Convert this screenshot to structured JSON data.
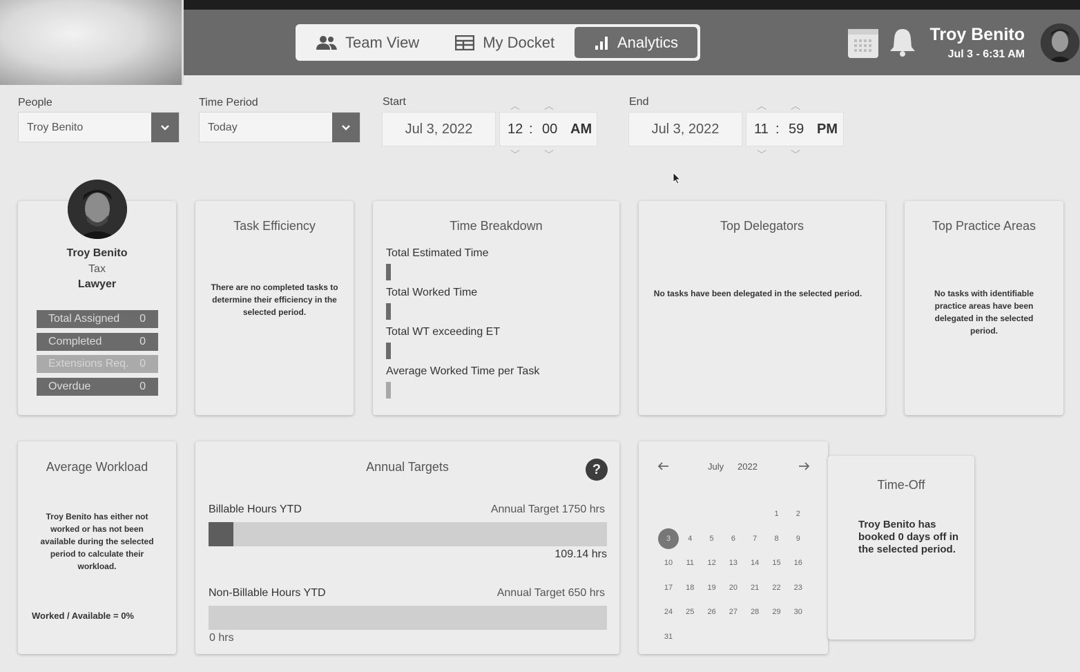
{
  "header": {
    "nav": [
      {
        "label": "Team View",
        "icon": "team-icon"
      },
      {
        "label": "My Docket",
        "icon": "docket-icon"
      },
      {
        "label": "Analytics",
        "icon": "bar-chart-icon",
        "active": true
      }
    ],
    "user": {
      "name": "Troy Benito",
      "datetime": "Jul 3 - 6:31 AM"
    }
  },
  "filters": {
    "people": {
      "label": "People",
      "value": "Troy Benito"
    },
    "time_period": {
      "label": "Time Period",
      "value": "Today"
    },
    "start": {
      "label": "Start",
      "date": "Jul 3, 2022",
      "hour": "12",
      "minute": "00",
      "ampm": "AM"
    },
    "end": {
      "label": "End",
      "date": "Jul 3, 2022",
      "hour": "11",
      "minute": "59",
      "ampm": "PM"
    },
    "time_separator": ":"
  },
  "profile": {
    "name": "Troy Benito",
    "department": "Tax",
    "role": "Lawyer",
    "stats": [
      {
        "label": "Total Assigned",
        "value": "0"
      },
      {
        "label": "Completed",
        "value": "0"
      },
      {
        "label": "Extensions Req.",
        "value": "0"
      },
      {
        "label": "Overdue",
        "value": "0"
      }
    ]
  },
  "task_efficiency": {
    "title": "Task Efficiency",
    "message": "There are no completed tasks to determine their efficiency in the selected period."
  },
  "time_breakdown": {
    "title": "Time Breakdown",
    "items": [
      {
        "label": "Total Estimated Time"
      },
      {
        "label": "Total Worked Time"
      },
      {
        "label": "Total WT exceeding ET"
      },
      {
        "label": "Average Worked Time per Task"
      }
    ]
  },
  "top_delegators": {
    "title": "Top Delegators",
    "message": "No tasks have been delegated in the selected period."
  },
  "top_practice_areas": {
    "title": "Top Practice Areas",
    "message": "No tasks with identifiable practice areas have been delegated in the selected period."
  },
  "average_workload": {
    "title": "Average Workload",
    "message": "Troy Benito has either not worked or has not been available during the selected period to calculate their workload.",
    "ratio": "Worked / Available = 0%"
  },
  "annual_targets": {
    "title": "Annual Targets",
    "help": "?",
    "billable": {
      "label": "Billable Hours YTD",
      "target": "Annual Target 1750 hrs",
      "value": "109.14 hrs",
      "fraction": 0.0624
    },
    "non_billable": {
      "label": "Non-Billable Hours YTD",
      "target": "Annual Target 650 hrs",
      "value": "0 hrs",
      "fraction": 0
    }
  },
  "calendar": {
    "month": "July",
    "year": "2022",
    "selected_day": 3,
    "days": [
      "1",
      "2",
      "3",
      "4",
      "5",
      "6",
      "7",
      "8",
      "9",
      "10",
      "11",
      "12",
      "13",
      "14",
      "15",
      "16",
      "17",
      "18",
      "19",
      "20",
      "21",
      "22",
      "23",
      "24",
      "25",
      "26",
      "27",
      "28",
      "29",
      "30",
      "31"
    ]
  },
  "time_off": {
    "title": "Time-Off",
    "message": "Troy Benito has booked 0 days off in the selected period."
  }
}
